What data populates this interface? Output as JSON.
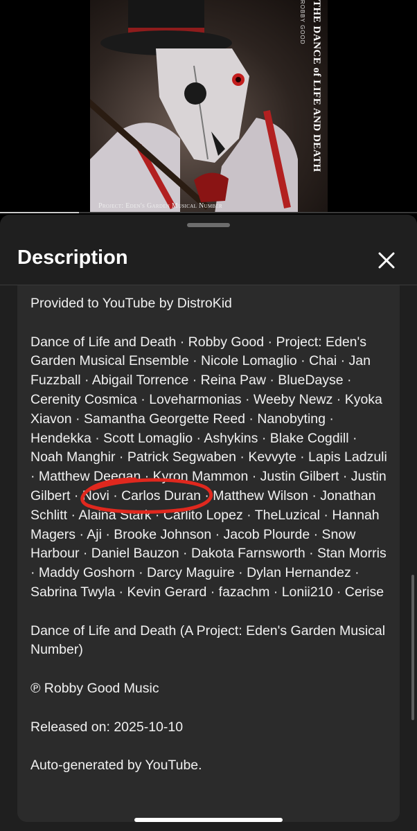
{
  "video": {
    "art_vertical_title": "THE DANCE of LIFE AND DEATH",
    "art_vertical_artist": "ROBBY GOOD",
    "art_caption": "Project: Eden's Garden Musical Number",
    "progress_fraction": 0.19
  },
  "sheet": {
    "title": "Description",
    "close_label": "Close"
  },
  "description": {
    "provided_by": "Provided to YouTube by DistroKid",
    "credits": "Dance of Life and Death · Robby Good · Project: Eden's Garden Musical Ensemble · Nicole Lomaglio · Chai · Jan Fuzzball · Abigail Torrence · Reina Paw · BlueDayse · Cerenity Cosmica · Loveharmonias · Weeby Newz · Kyoka Xiavon · Samantha Georgette Reed · Nanobyting · Hendekka · Scott Lomaglio · Ashykins · Blake Cogdill · Noah Manghir · Patrick Segwaben · Kevvyte · Lapis Ladzuli · Matthew Deegan · Kyron Mammon · Justin Gilbert · Justin Gilbert · Novi · Carlos Duran · Matthew Wilson · Jonathan Schlitt · Alaina Stark · Carlito Lopez · TheLuzical · Hannah Magers · Aji · Brooke Johnson · Jacob Plourde · Snow Harbour · Daniel Bauzon · Dakota Farnsworth · Stan Morris · Maddy Goshorn · Darcy Maguire · Dylan Hernandez · Sabrina Twyla · Kevin Gerard · fazachm · Lonii210 · Cerise",
    "track_title": "Dance of Life and Death (A Project: Eden's Garden Musical Number)",
    "copyright": "℗ Robby Good Music",
    "released": "Released on: 2025-10-10",
    "auto_generated": "Auto-generated by YouTube."
  },
  "colors": {
    "sheet_bg": "#1f1f1f",
    "card_bg": "#2b2b2b",
    "annotation": "#e0281e"
  }
}
